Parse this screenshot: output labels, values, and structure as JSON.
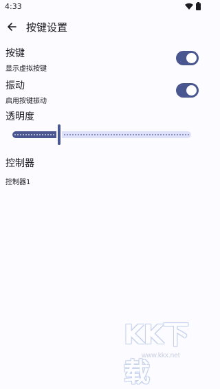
{
  "status_bar": {
    "time": "4:33",
    "wifi_icon": "wifi-icon",
    "battery_icon": "battery-icon"
  },
  "app_bar": {
    "title": "按键设置",
    "back_icon": "arrow-back-icon"
  },
  "settings": {
    "buttons": {
      "title": "按键",
      "subtitle": "显示虚拟按键",
      "enabled": true
    },
    "vibration": {
      "title": "振动",
      "subtitle": "启用按键振动",
      "enabled": true
    }
  },
  "opacity": {
    "label": "透明度",
    "value_fraction": 0.26
  },
  "controllers": {
    "title": "控制器",
    "items": [
      "控制器1"
    ]
  },
  "watermark": {
    "text": "KK下载",
    "url": "www.kkx.net"
  },
  "colors": {
    "accent": "#4A568F",
    "track_inactive": "#DEE1F9",
    "background": "#FCFBFF"
  }
}
